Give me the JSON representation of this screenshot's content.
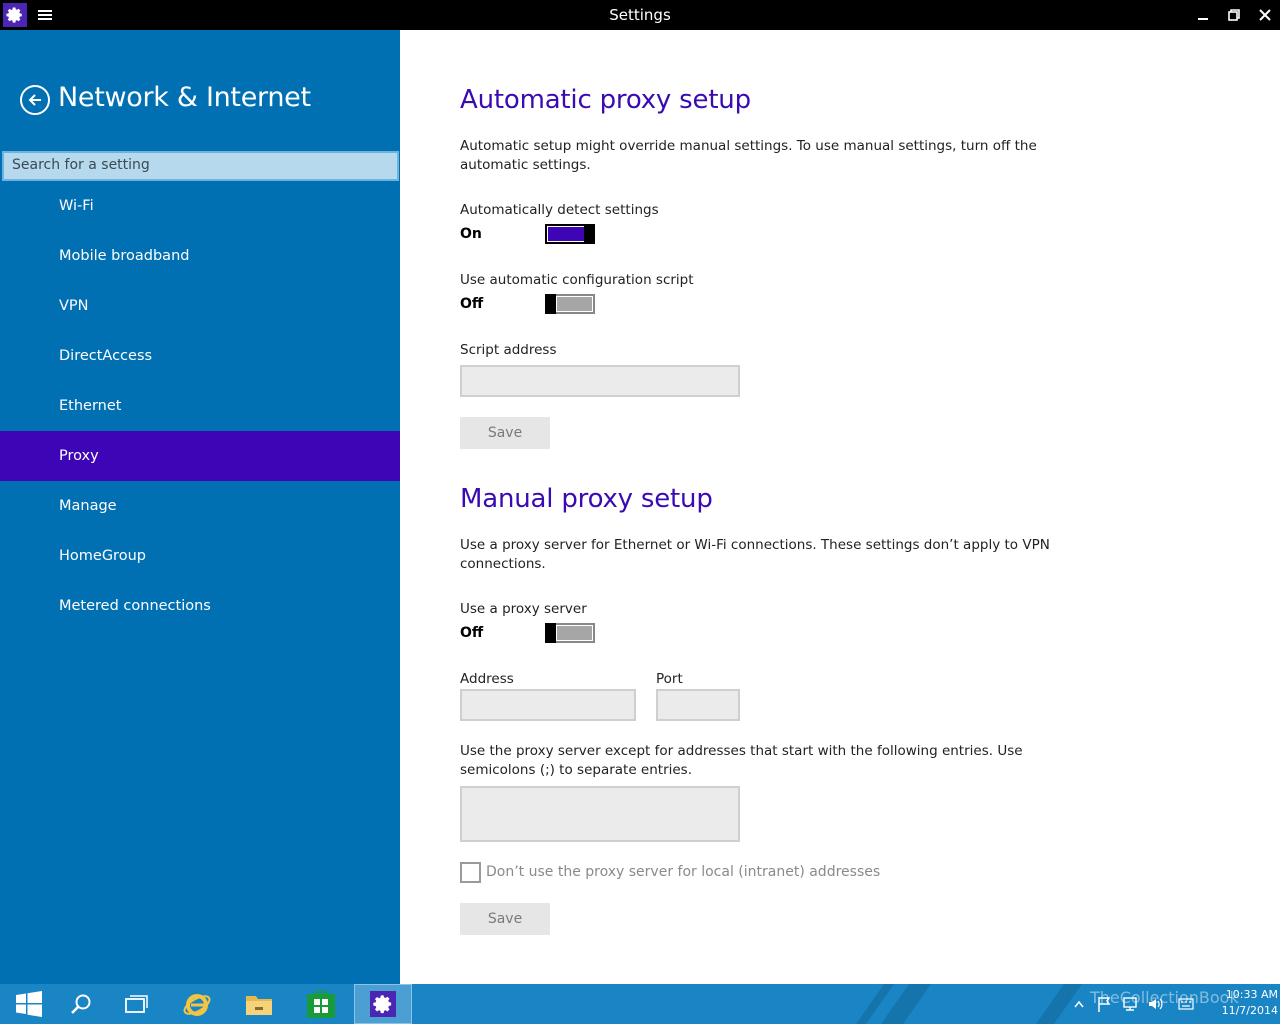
{
  "window": {
    "title": "Settings"
  },
  "sidebar": {
    "section_title": "Network & Internet",
    "search_placeholder": "Search for a setting",
    "items": [
      {
        "label": "Wi-Fi"
      },
      {
        "label": "Mobile broadband"
      },
      {
        "label": "VPN"
      },
      {
        "label": "DirectAccess"
      },
      {
        "label": "Ethernet"
      },
      {
        "label": "Proxy",
        "selected": true
      },
      {
        "label": "Manage"
      },
      {
        "label": "HomeGroup"
      },
      {
        "label": "Metered connections"
      }
    ]
  },
  "automatic": {
    "heading": "Automatic proxy setup",
    "description": "Automatic setup might override manual settings. To use manual settings, turn off the automatic settings.",
    "detect_label": "Automatically detect settings",
    "detect_state": "On",
    "script_label": "Use automatic configuration script",
    "script_state": "Off",
    "script_address_label": "Script address",
    "script_address_value": "",
    "save_label": "Save"
  },
  "manual": {
    "heading": "Manual proxy setup",
    "description": "Use a proxy server for Ethernet or Wi-Fi connections. These settings don’t apply to VPN connections.",
    "use_proxy_label": "Use a proxy server",
    "use_proxy_state": "Off",
    "address_label": "Address",
    "address_value": "",
    "port_label": "Port",
    "port_value": "",
    "exceptions_label": "Use the proxy server except for addresses that start with the following entries. Use semicolons (;) to separate entries.",
    "exceptions_value": "",
    "local_checkbox_label": "Don’t use the proxy server for local (intranet) addresses",
    "local_checkbox_checked": false,
    "save_label": "Save"
  },
  "taskbar": {
    "apps": [
      "start-icon",
      "search-icon",
      "task-view-icon",
      "internet-explorer-icon",
      "file-explorer-icon",
      "store-icon",
      "settings-icon"
    ],
    "watermark": "TheCollectionBook",
    "time": "10:33 AM",
    "date": "11/7/2014"
  },
  "colors": {
    "accent": "#3e05b6",
    "sidebar": "#0170b3",
    "heading": "#3a0bb3",
    "taskbar": "#1a85c4"
  }
}
